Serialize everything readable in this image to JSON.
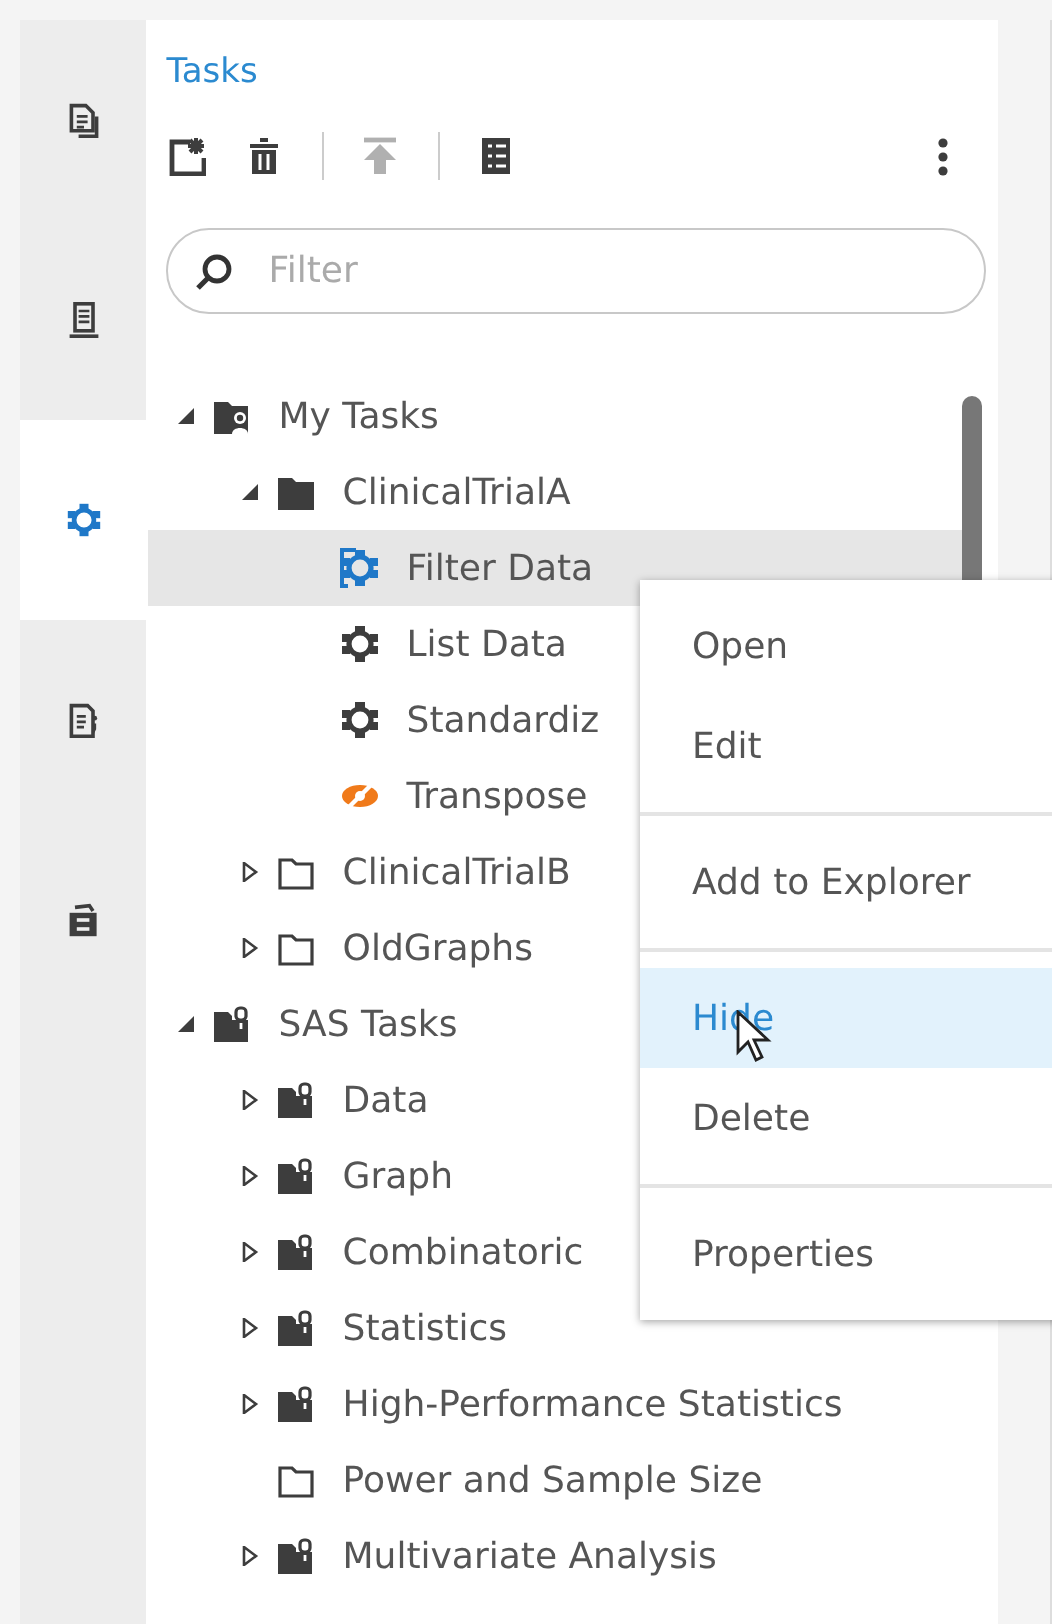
{
  "rail_tabs": [
    {
      "kind": "documents",
      "selected": false
    },
    {
      "kind": "server",
      "selected": false
    },
    {
      "kind": "tasks",
      "selected": true
    },
    {
      "kind": "snippets",
      "selected": false
    },
    {
      "kind": "cabinet",
      "selected": false
    }
  ],
  "panel": {
    "title": "Tasks",
    "toolbar": [
      {
        "kind": "new",
        "disabled": false
      },
      {
        "kind": "delete",
        "disabled": false
      },
      {
        "kind": "divider"
      },
      {
        "kind": "upload",
        "disabled": true
      },
      {
        "kind": "divider"
      },
      {
        "kind": "list",
        "disabled": false
      },
      {
        "kind": "more",
        "disabled": false
      }
    ],
    "search": {
      "placeholder": "Filter"
    },
    "tree": [
      {
        "label": "My Tasks",
        "kind": "user-folder",
        "expanded": true,
        "selected": false,
        "children": [
          {
            "label": "ClinicalTrialA",
            "kind": "folder",
            "expanded": true,
            "selected": false,
            "children": [
              {
                "label": "Filter Data",
                "kind": "task-active",
                "selected": true
              },
              {
                "label": "List Data",
                "kind": "task",
                "selected": false
              },
              {
                "label": "Standardiz",
                "kind": "task",
                "selected": false
              },
              {
                "label": "Transpose",
                "kind": "task-hidden",
                "selected": false
              }
            ]
          },
          {
            "label": "ClinicalTrialB",
            "kind": "folder-outline",
            "expanded": false,
            "selected": false
          },
          {
            "label": "OldGraphs",
            "kind": "folder-outline",
            "expanded": false,
            "selected": false
          }
        ]
      },
      {
        "label": "SAS Tasks",
        "kind": "locked-folder",
        "expanded": true,
        "selected": false,
        "children": [
          {
            "label": "Data",
            "kind": "locked-folder",
            "expanded": false,
            "selected": false
          },
          {
            "label": "Graph",
            "kind": "locked-folder",
            "expanded": false,
            "selected": false
          },
          {
            "label": "Combinatoric",
            "kind": "locked-folder",
            "expanded": false,
            "selected": false
          },
          {
            "label": "Statistics",
            "kind": "locked-folder",
            "expanded": false,
            "selected": false
          },
          {
            "label": "High-Performance Statistics",
            "kind": "locked-folder",
            "expanded": false,
            "selected": false
          },
          {
            "label": "Power and Sample Size",
            "kind": "folder-outline",
            "selected": false
          },
          {
            "label": "Multivariate Analysis",
            "kind": "locked-folder",
            "expanded": false,
            "selected": false
          }
        ]
      }
    ]
  },
  "context_menu": [
    [
      {
        "label": "Open",
        "selected": false
      },
      {
        "label": "Edit",
        "selected": false
      }
    ],
    [
      {
        "label": "Add to Explorer",
        "selected": false
      }
    ],
    [
      {
        "label": "Hide",
        "selected": true
      },
      {
        "label": "Delete",
        "selected": false
      }
    ],
    [
      {
        "label": "Properties",
        "selected": false
      }
    ]
  ]
}
